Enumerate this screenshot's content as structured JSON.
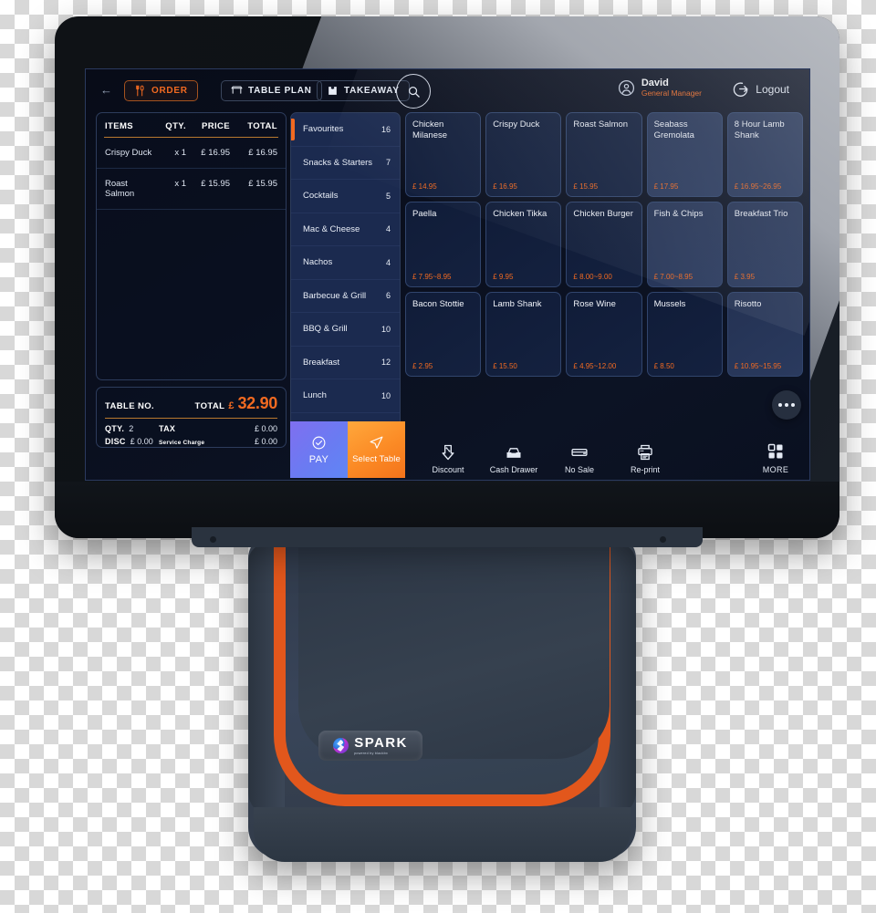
{
  "device": {
    "brand": "SPARK",
    "brand_tagline": "powered by blackbx",
    "accent_orange": "#f26a21",
    "stand_color": "#3a4454"
  },
  "topbar": {
    "back_label": "←",
    "nav": [
      {
        "label": "ORDER",
        "icon": "cutlery-icon",
        "active": true
      },
      {
        "label": "TABLE PLAN",
        "icon": "table-icon",
        "active": false
      },
      {
        "label": "TAKEAWAY",
        "icon": "takeaway-bag-icon",
        "active": false
      }
    ],
    "search_icon": "search-icon",
    "user": {
      "name": "David",
      "role": "General Manager",
      "icon": "user-circle-icon"
    },
    "logout": {
      "label": "Logout",
      "icon": "logout-icon"
    }
  },
  "order_panel": {
    "columns": [
      "ITEMS",
      "QTY.",
      "PRICE",
      "TOTAL"
    ],
    "rows": [
      {
        "item": "Crispy Duck",
        "qty": "x 1",
        "price": "£ 16.95",
        "total": "£ 16.95"
      },
      {
        "item": "Roast Salmon",
        "qty": "x 1",
        "price": "£ 15.95",
        "total": "£ 15.95"
      }
    ]
  },
  "totals": {
    "table_no_label": "TABLE NO.",
    "table_no_value": "",
    "total_label": "TOTAL",
    "currency": "£",
    "total_value": "32.90",
    "qty_label": "QTY.",
    "qty_value": "2",
    "disc_label": "DISC",
    "disc_value": "£ 0.00",
    "tax_label": "TAX",
    "tax_value": "£ 0.00",
    "service_label": "Service Charge",
    "service_value": "£ 0.00"
  },
  "categories": [
    {
      "name": "Favourites",
      "count": "16",
      "active": true
    },
    {
      "name": "Snacks & Starters",
      "count": "7",
      "active": false
    },
    {
      "name": "Cocktails",
      "count": "5",
      "active": false
    },
    {
      "name": "Mac & Cheese",
      "count": "4",
      "active": false
    },
    {
      "name": "Nachos",
      "count": "4",
      "active": false
    },
    {
      "name": "Barbecue & Grill",
      "count": "6",
      "active": false
    },
    {
      "name": "BBQ & Grill",
      "count": "10",
      "active": false
    },
    {
      "name": "Breakfast",
      "count": "12",
      "active": false
    },
    {
      "name": "Lunch",
      "count": "10",
      "active": false
    }
  ],
  "products": [
    {
      "name": "Chicken Milanese",
      "price": "£ 14.95",
      "shade": "dk"
    },
    {
      "name": "Crispy Duck",
      "price": "£ 16.95",
      "shade": "dk"
    },
    {
      "name": "Roast Salmon",
      "price": "£ 15.95",
      "shade": "dk"
    },
    {
      "name": "Seabass Gremolata",
      "price": "£ 17.95",
      "shade": "lt"
    },
    {
      "name": "8 Hour Lamb Shank",
      "price": "£ 16.95~26.95",
      "shade": "lt"
    },
    {
      "name": "Paella",
      "price": "£ 7.95~8.95",
      "shade": "dk"
    },
    {
      "name": "Chicken Tikka",
      "price": "£ 9.95",
      "shade": "dk"
    },
    {
      "name": "Chicken Burger",
      "price": "£ 8.00~9.00",
      "shade": "dk"
    },
    {
      "name": "Fish & Chips",
      "price": "£ 7.00~8.95",
      "shade": "lt"
    },
    {
      "name": "Breakfast Trio",
      "price": "£ 3.95",
      "shade": "lt"
    },
    {
      "name": "Bacon Stottie",
      "price": "£ 2.95",
      "shade": "dk"
    },
    {
      "name": "Lamb Shank",
      "price": "£ 15.50",
      "shade": "dk"
    },
    {
      "name": "Rose Wine",
      "price": "£ 4.95~12.00",
      "shade": "dk"
    },
    {
      "name": "Mussels",
      "price": "£ 8.50",
      "shade": "dk"
    },
    {
      "name": "Risotto",
      "price": "£ 10.95~15.95",
      "shade": "lt"
    }
  ],
  "more_fab": {
    "icon": "ellipsis-icon"
  },
  "actionbar": {
    "pay": {
      "label": "PAY",
      "icon": "check-circle-icon"
    },
    "select_table": {
      "label": "Select Table",
      "icon": "paper-plane-icon"
    },
    "buttons": [
      {
        "label": "Discount",
        "icon": "discount-icon"
      },
      {
        "label": "Cash Drawer",
        "icon": "cash-drawer-icon"
      },
      {
        "label": "No Sale",
        "icon": "no-sale-icon"
      },
      {
        "label": "Re-print",
        "icon": "printer-icon"
      }
    ],
    "more": {
      "label": "MORE",
      "icon": "grid-icon"
    }
  }
}
